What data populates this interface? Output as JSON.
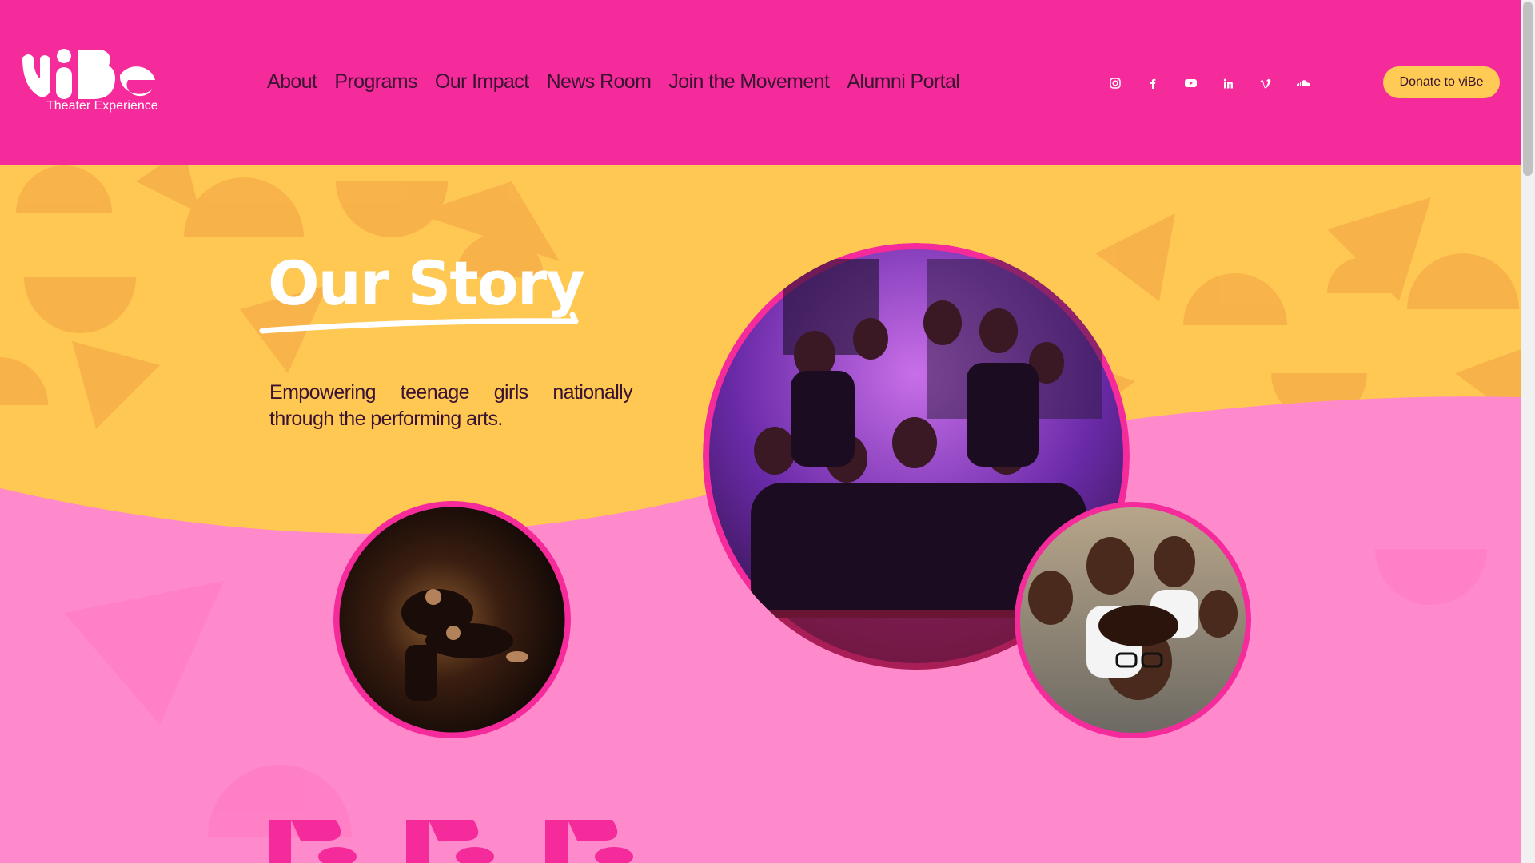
{
  "brand": {
    "logo_wordmark": "viBe",
    "logo_subtitle": "Theater Experience"
  },
  "nav": {
    "items": [
      {
        "label": "About"
      },
      {
        "label": "Programs"
      },
      {
        "label": "Our Impact"
      },
      {
        "label": "News Room"
      },
      {
        "label": "Join the Movement"
      },
      {
        "label": "Alumni Portal"
      }
    ]
  },
  "social": [
    {
      "icon": "instagram-icon"
    },
    {
      "icon": "facebook-icon"
    },
    {
      "icon": "youtube-icon"
    },
    {
      "icon": "linkedin-icon"
    },
    {
      "icon": "vimeo-icon"
    },
    {
      "icon": "soundcloud-icon"
    }
  ],
  "header": {
    "donate_label": "Donate to viBe"
  },
  "hero": {
    "title": "Our Story",
    "tagline": "Empowering teenage girls nationally through the performing arts."
  },
  "colors": {
    "header_bg": "#f52a9b",
    "yellow_bg": "#ffc853",
    "pink_bg": "#ff8acb",
    "text_dark": "#3a1330",
    "button_bg": "#ffcb54",
    "ring": "#f52a9b"
  }
}
